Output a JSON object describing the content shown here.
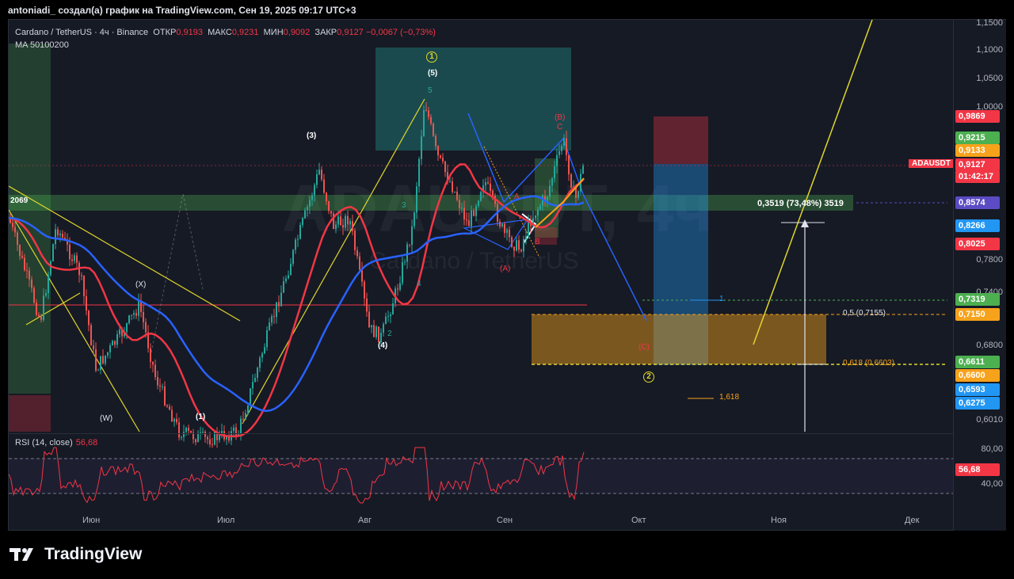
{
  "caption": "antoniadi_ создал(а) график на TradingView.com, Сен 19, 2025 09:17 UTC+3",
  "legend": {
    "symbol": "Cardano / TetherUS · 4ч · Binance",
    "open_label": "ОТКР",
    "open": "0,9193",
    "high_label": "МАКС",
    "high": "0,9231",
    "low_label": "МИН",
    "low": "0,9092",
    "close_label": "ЗАКР",
    "close": "0,9127",
    "change": "−0,0067 (−0,73%)",
    "ma": "MA 50100200"
  },
  "watermark": {
    "big": "ADAUSDT, 4ч",
    "small": "Cardano / TetherUS"
  },
  "rsi_legend": {
    "label": "RSI (14, close)",
    "value": "56,68"
  },
  "price_axis_ticks": [
    "1,1500",
    "1,1000",
    "1,0500",
    "1,0000",
    "0,7800",
    "0,7400",
    "0,6800",
    "0,6010"
  ],
  "rsi_axis_ticks": [
    "80,00",
    "40,00"
  ],
  "price_tags": [
    {
      "text": "0,9869",
      "color": "#f23645"
    },
    {
      "text": "0,9215",
      "color": "#4caf50"
    },
    {
      "text": "0,9133",
      "color": "#f7a21b"
    },
    {
      "text": "0,9127",
      "color": "#f23645"
    },
    {
      "text": "01:42:17",
      "color": "#f23645"
    },
    {
      "text": "0,8574",
      "color": "#5b4bc4"
    },
    {
      "text": "0,8266",
      "color": "#2196f3"
    },
    {
      "text": "0,8025",
      "color": "#f23645"
    },
    {
      "text": "0,7319",
      "color": "#4caf50"
    },
    {
      "text": "0,7150",
      "color": "#f7a21b"
    },
    {
      "text": "0,6611",
      "color": "#4caf50"
    },
    {
      "text": "0,6600",
      "color": "#f7a21b"
    },
    {
      "text": "0,6593",
      "color": "#2196f3"
    },
    {
      "text": "0,6275",
      "color": "#2196f3"
    },
    {
      "text": "56,68",
      "color": "#f23645"
    }
  ],
  "symbol_tag": "ADAUSDT",
  "time_labels": [
    "Июн",
    "Июл",
    "Авг",
    "Сен",
    "Окт",
    "Ноя",
    "Дек"
  ],
  "annotations": {
    "measure": "0,3519 (73,48%) 3519",
    "level_left": "2069",
    "fib_05": "0,5 (0,7155)",
    "fib_0618": "0,618 (0,6603)",
    "fib_1618": "1,618",
    "fib_1": "1",
    "w_x": "(X)",
    "w_w": "(W)",
    "w_1": "(1)",
    "w_3": "(3)",
    "w_4": "(4)",
    "w_5": "(5)",
    "w_circle1": "1",
    "w_circle2": "2",
    "sub5": "5",
    "sub3": "3",
    "sub4": "4",
    "sub2": "2",
    "b_paren": "(B)",
    "c_small": "C",
    "a_paren": "(A)",
    "a_small": "A",
    "b_small": "B",
    "c_paren": "(C)"
  },
  "brand": "TradingView",
  "chart_data": {
    "type": "line",
    "title": "Cardano / TetherUS · 4ч · Binance",
    "x": [
      "Июн",
      "Июл",
      "Авг",
      "Сен",
      "Окт",
      "Ноя",
      "Дек"
    ],
    "series": [
      {
        "name": "ADAUSDT",
        "values": [
          0.74,
          0.58,
          0.82,
          0.83,
          0.91
        ]
      }
    ],
    "ylim": [
      0.6,
      1.15
    ],
    "rsi": {
      "value": 56.68,
      "levels": [
        80,
        40
      ]
    }
  }
}
